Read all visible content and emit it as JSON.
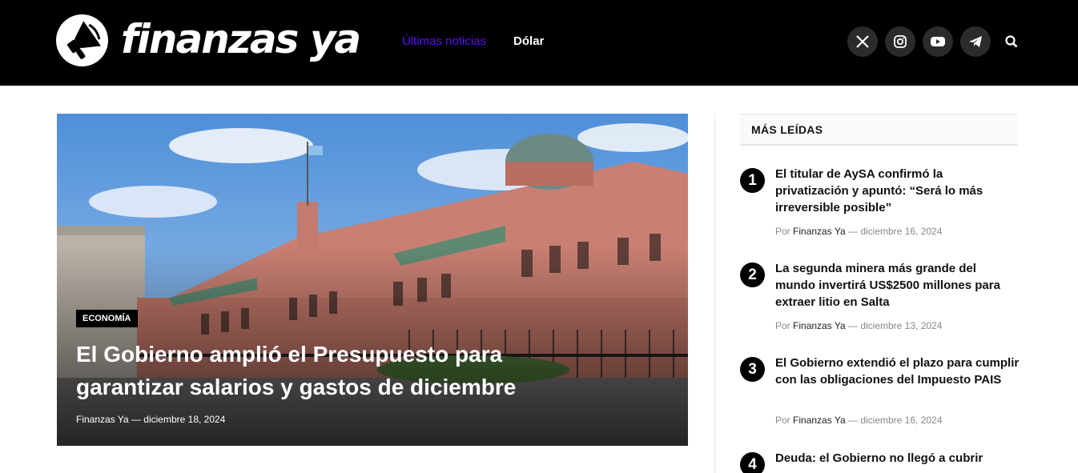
{
  "header": {
    "brand": "finanzas ya",
    "nav": [
      {
        "label": "Últimas noticias",
        "active": true
      },
      {
        "label": "Dólar",
        "active": false
      }
    ],
    "socials": [
      "x-icon",
      "instagram-icon",
      "youtube-icon",
      "telegram-icon"
    ],
    "search_icon": "search-icon",
    "accent": "#5b0fff"
  },
  "hero": {
    "category": "ECONOMÍA",
    "title": "El Gobierno amplió el Presupuesto para garantizar salarios y gastos de diciembre",
    "author": "Finanzas Ya",
    "separator": "—",
    "date": "diciembre 18, 2024"
  },
  "sidebar": {
    "title": "MÁS LEÍDAS",
    "by": "Por",
    "separator": "—",
    "items": [
      {
        "rank": "1",
        "title": "El titular de AySA confirmó la privatización y apuntó: “Será lo más irreversible posible”",
        "author": "Finanzas Ya",
        "date": "diciembre 16, 2024"
      },
      {
        "rank": "2",
        "title": "La segunda minera más grande del mundo invertirá US$2500 millones para extraer litio en Salta",
        "author": "Finanzas Ya",
        "date": "diciembre 13, 2024"
      },
      {
        "rank": "3",
        "title": "El Gobierno extendió el plazo para cumplir con las obligaciones del Impuesto PAIS",
        "author": "Finanzas Ya",
        "date": "diciembre 16, 2024"
      },
      {
        "rank": "4",
        "title": "Deuda: el Gobierno no llegó a cubrir"
      }
    ]
  }
}
